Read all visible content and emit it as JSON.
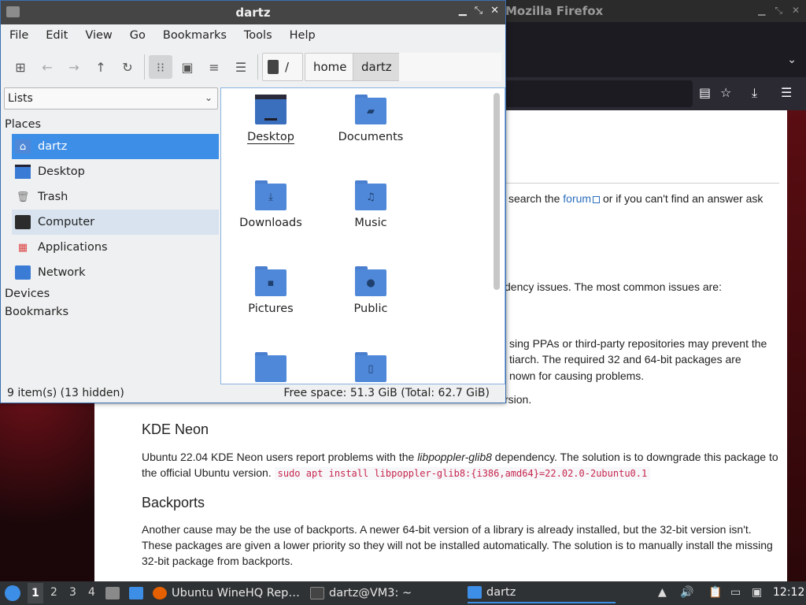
{
  "firefox": {
    "title": "Mozilla Firefox",
    "content": {
      "line_forum_before": "search the ",
      "forum_link": "forum",
      "line_forum_after": " or if you can't find an answer ask",
      "line_dependency": "dency issues. The most common issues are:",
      "line_ppa_1": "sing PPAs or third-party repositories may prevent the",
      "line_ppa_2": "tiarch. The required 32 and 64-bit packages are",
      "line_ppa_3": "nown for causing problems.",
      "line_version": "rsion.",
      "kde_heading": "KDE Neon",
      "kde_text_before": "Ubuntu 22.04 KDE Neon users report problems with the ",
      "kde_pkg": "libpoppler-glib8",
      "kde_text_after": " dependency. The solution is to downgrade this package to",
      "kde_text_line2": "the official Ubuntu version.",
      "kde_code": "sudo apt install libpoppler-glib8:{i386,amd64}=22.02.0-2ubuntu0.1",
      "backports_heading": "Backports",
      "backports_line1": "Another cause may be the use of backports. A newer 64-bit version of a library is already installed, but the 32-bit version isn't.",
      "backports_line2": "These packages are given a lower priority so they will not be installed automatically. The solution is to manually install the missing",
      "backports_line3": "32-bit package from backports."
    }
  },
  "file_manager": {
    "title": "dartz",
    "menu": [
      "File",
      "Edit",
      "View",
      "Go",
      "Bookmarks",
      "Tools",
      "Help"
    ],
    "breadcrumb": {
      "root": "/",
      "home": "home",
      "current": "dartz"
    },
    "side_pane_mode": "Lists",
    "sections": {
      "places": "Places",
      "devices": "Devices",
      "bookmarks": "Bookmarks"
    },
    "places": [
      {
        "label": "dartz",
        "icon": "home-folder-icon"
      },
      {
        "label": "Desktop",
        "icon": "desktop-icon"
      },
      {
        "label": "Trash",
        "icon": "trash-icon"
      },
      {
        "label": "Computer",
        "icon": "computer-icon"
      },
      {
        "label": "Applications",
        "icon": "applications-icon"
      },
      {
        "label": "Network",
        "icon": "network-icon"
      }
    ],
    "files": [
      {
        "name": "Desktop",
        "icon": "desktop-folder-icon"
      },
      {
        "name": "Documents",
        "icon": "documents-folder-icon"
      },
      {
        "name": "Downloads",
        "icon": "downloads-folder-icon"
      },
      {
        "name": "Music",
        "icon": "music-folder-icon"
      },
      {
        "name": "Pictures",
        "icon": "pictures-folder-icon"
      },
      {
        "name": "Public",
        "icon": "public-folder-icon"
      }
    ],
    "status": {
      "items": "9 item(s) (13 hidden)",
      "free_space": "Free space: 51.3 GiB (Total: 62.7 GiB)"
    }
  },
  "taskbar": {
    "workspaces": [
      "1",
      "2",
      "3",
      "4"
    ],
    "tasks": [
      {
        "label": "Ubuntu WineHQ Rep…",
        "icon": "firefox-icon"
      },
      {
        "label": "dartz@VM3: ~",
        "icon": "terminal-icon"
      },
      {
        "label": "dartz",
        "icon": "folder-icon"
      }
    ],
    "clock": "12:12"
  }
}
